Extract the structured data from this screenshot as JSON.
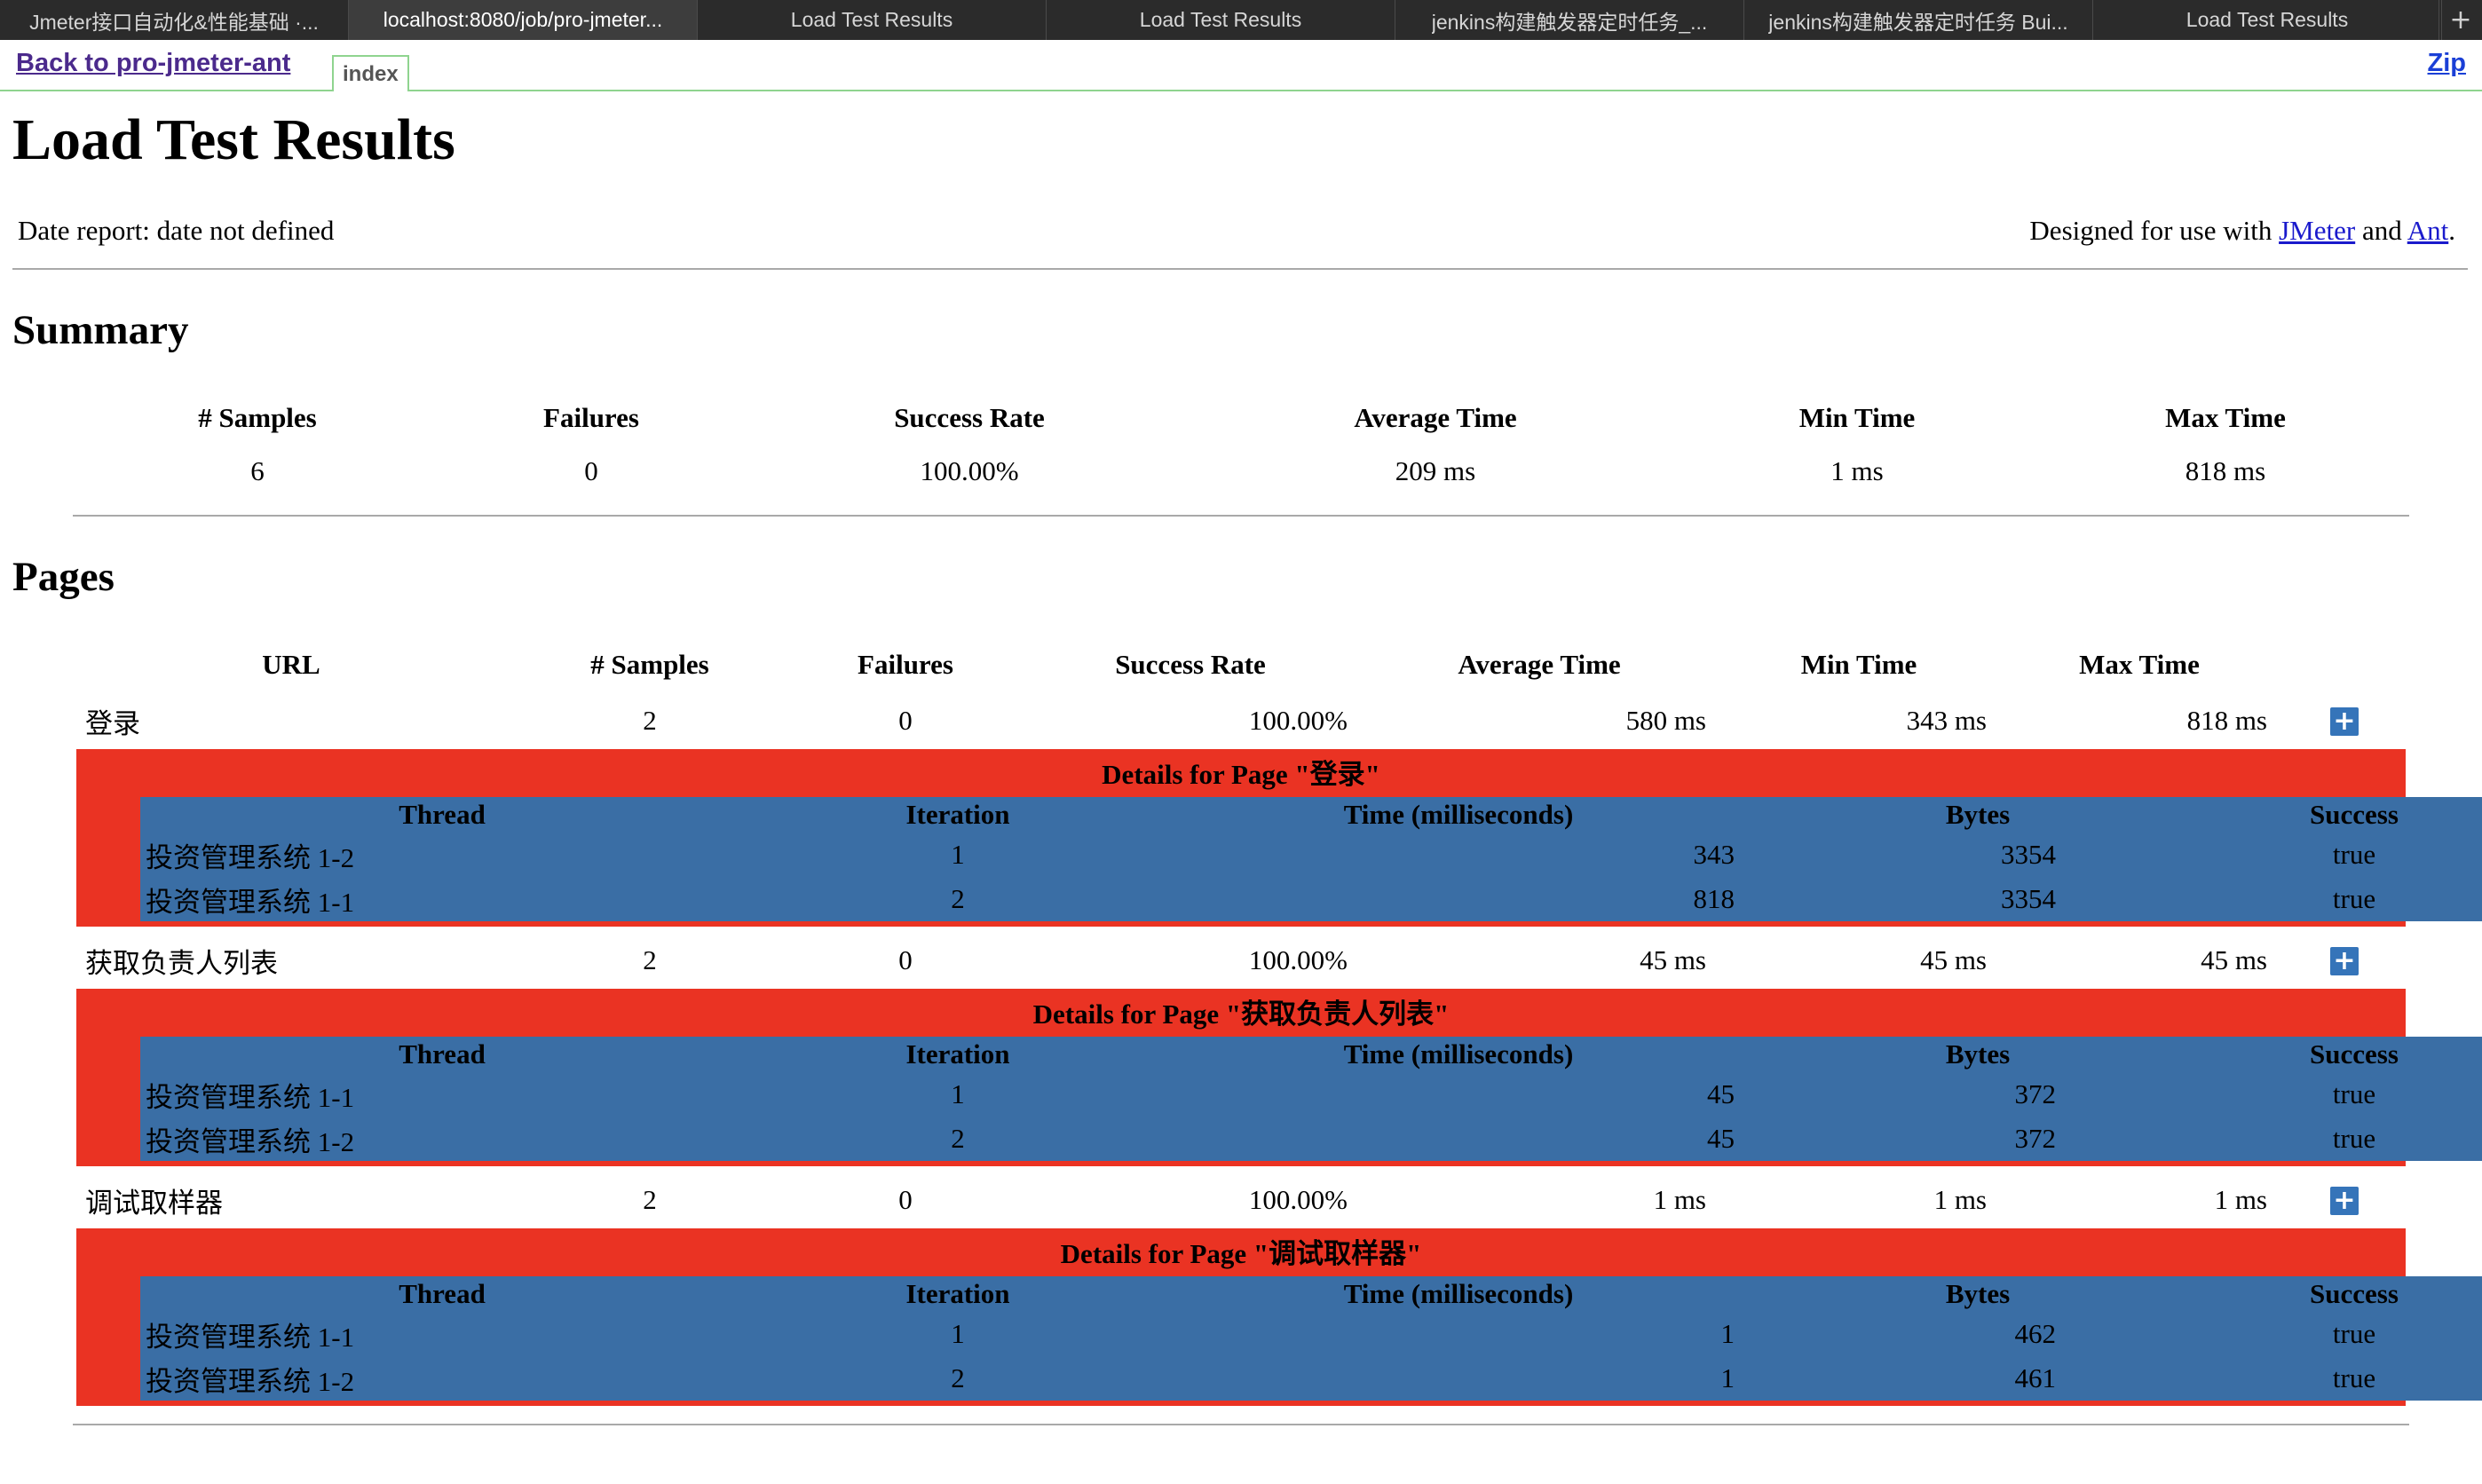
{
  "browser": {
    "tabs": [
      {
        "title": "Jmeter接口自动化&性能基础 ·...",
        "active": false
      },
      {
        "title": "localhost:8080/job/pro-jmeter...",
        "active": true
      },
      {
        "title": "Load Test Results",
        "active": false
      },
      {
        "title": "Load Test Results",
        "active": false
      },
      {
        "title": "jenkins构建触发器定时任务_...",
        "active": false
      },
      {
        "title": "jenkins构建触发器定时任务 Bui...",
        "active": false
      },
      {
        "title": "Load Test Results",
        "active": false
      }
    ],
    "new_tab_glyph": "+"
  },
  "nav": {
    "back_label": "Back to pro-jmeter-ant",
    "index_tab": "index",
    "zip_label": "Zip"
  },
  "report": {
    "title": "Load Test Results",
    "date_line": "Date report: date not defined",
    "designed_prefix": "Designed for use with ",
    "jmeter_link": "JMeter",
    "and_text": " and ",
    "ant_link": "Ant",
    "period": "."
  },
  "summary": {
    "heading": "Summary",
    "headers": [
      "# Samples",
      "Failures",
      "Success Rate",
      "Average Time",
      "Min Time",
      "Max Time"
    ],
    "values": [
      "6",
      "0",
      "100.00%",
      "209 ms",
      "1 ms",
      "818 ms"
    ]
  },
  "pages": {
    "heading": "Pages",
    "headers": [
      "URL",
      "# Samples",
      "Failures",
      "Success Rate",
      "Average Time",
      "Min Time",
      "Max Time"
    ],
    "expand_glyph": "+",
    "detail_headers": [
      "Thread",
      "Iteration",
      "Time (milliseconds)",
      "Bytes",
      "Success"
    ],
    "rows": [
      {
        "url": "登录",
        "samples": "2",
        "failures": "0",
        "success_rate": "100.00%",
        "avg": "580 ms",
        "min": "343 ms",
        "max": "818 ms",
        "details_title": "Details for Page \"登录\"",
        "details": [
          {
            "thread": "投资管理系统 1-2",
            "iteration": "1",
            "time": "343",
            "bytes": "3354",
            "success": "true"
          },
          {
            "thread": "投资管理系统 1-1",
            "iteration": "2",
            "time": "818",
            "bytes": "3354",
            "success": "true"
          }
        ]
      },
      {
        "url": "获取负责人列表",
        "samples": "2",
        "failures": "0",
        "success_rate": "100.00%",
        "avg": "45 ms",
        "min": "45 ms",
        "max": "45 ms",
        "details_title": "Details for Page \"获取负责人列表\"",
        "details": [
          {
            "thread": "投资管理系统 1-1",
            "iteration": "1",
            "time": "45",
            "bytes": "372",
            "success": "true"
          },
          {
            "thread": "投资管理系统 1-2",
            "iteration": "2",
            "time": "45",
            "bytes": "372",
            "success": "true"
          }
        ]
      },
      {
        "url": "调试取样器",
        "samples": "2",
        "failures": "0",
        "success_rate": "100.00%",
        "avg": "1 ms",
        "min": "1 ms",
        "max": "1 ms",
        "details_title": "Details for Page \"调试取样器\"",
        "details": [
          {
            "thread": "投资管理系统 1-1",
            "iteration": "1",
            "time": "1",
            "bytes": "462",
            "success": "true"
          },
          {
            "thread": "投资管理系统 1-2",
            "iteration": "2",
            "time": "1",
            "bytes": "461",
            "success": "true"
          }
        ]
      }
    ]
  },
  "colors": {
    "details_background": "#ea3323",
    "details_table_background": "#3a6ea5",
    "expand_icon": "#3574b9",
    "nav_border": "#8fd48f",
    "link": "#1a1acc"
  }
}
